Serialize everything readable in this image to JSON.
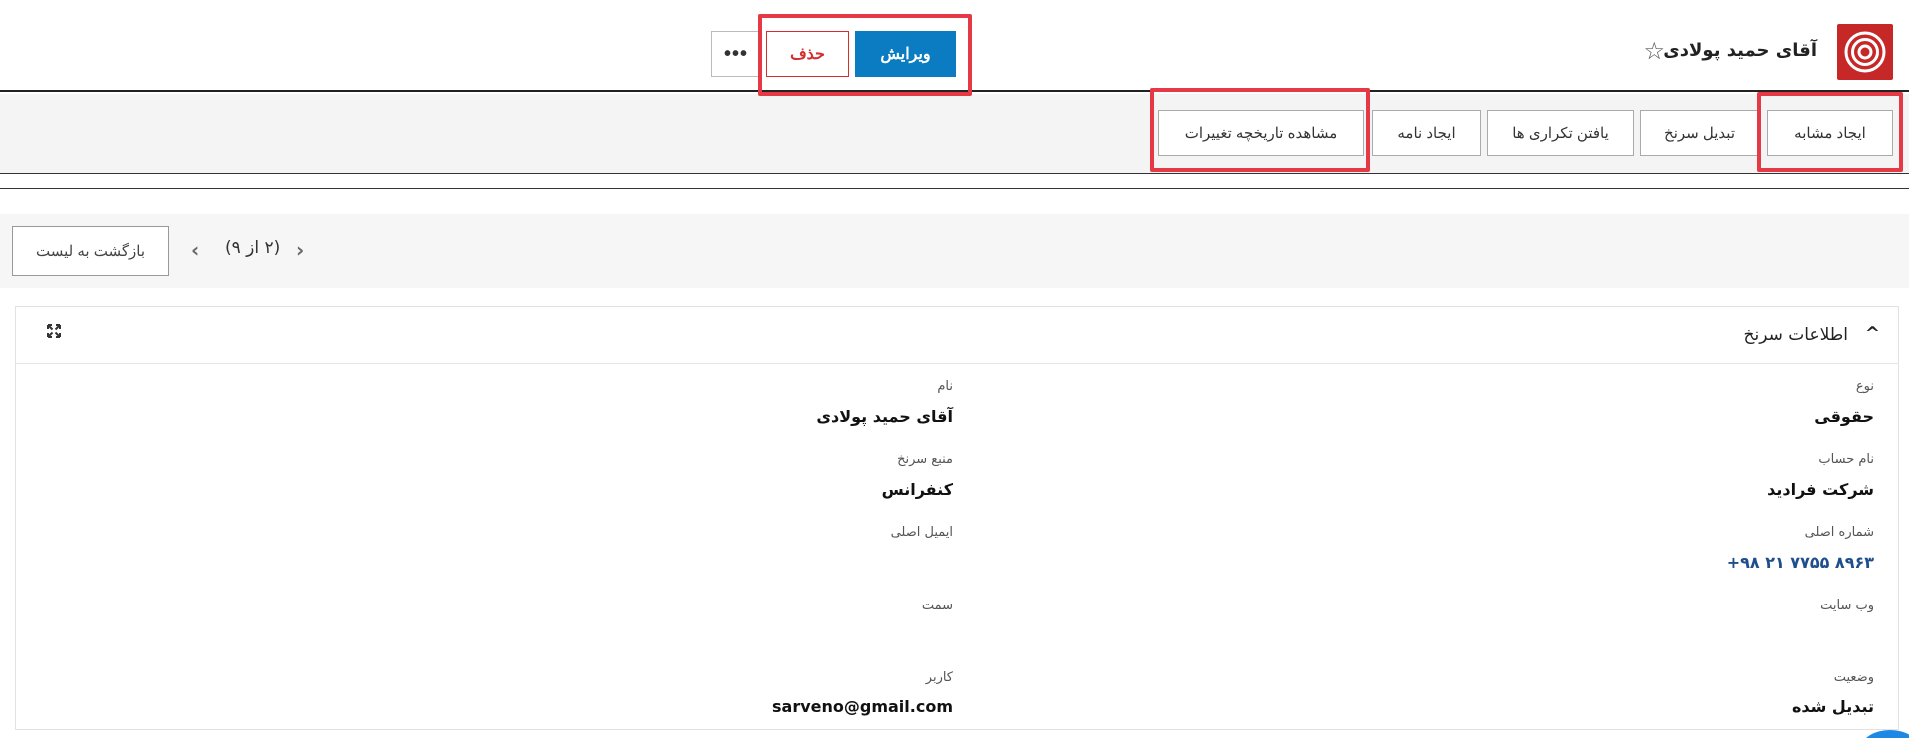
{
  "header": {
    "title": "آقای حمید پولادی",
    "edit_label": "ویرایش",
    "delete_label": "حذف",
    "more_label": "•••"
  },
  "toolbar": {
    "buttons": [
      {
        "label": "ایجاد مشابه"
      },
      {
        "label": "تبدیل سرنخ"
      },
      {
        "label": "یافتن تکراری ها"
      },
      {
        "label": "ایجاد نامه"
      },
      {
        "label": "مشاهده تاریخچه تغییرات"
      }
    ]
  },
  "nav": {
    "back_label": "بازگشت به لیست",
    "pager": "(۲ از ۹)"
  },
  "panel": {
    "title": "اطلاعات سرنخ",
    "fields": {
      "type_label": "نوع",
      "type_value": "حقوقی",
      "name_label": "نام",
      "name_value": "آقای حمید پولادی",
      "account_label": "نام حساب",
      "account_value": "شرکت فرادید",
      "source_label": "منبع سرنخ",
      "source_value": "کنفرانس",
      "phone_label": "شماره اصلی",
      "phone_value": "+۹۸ ۲۱ ۷۷۵۵ ۸۹۶۳",
      "email_label": "ایمیل اصلی",
      "website_label": "وب سایت",
      "position_label": "سمت",
      "status_label": "وضعیت",
      "status_value": "تبدیل شده",
      "user_label": "کاربر",
      "user_value": "sarveno@gmail.com"
    }
  },
  "colors": {
    "primary": "#0b7cc1",
    "danger": "#d32f2f",
    "brand": "#c62828",
    "highlight": "#e53945"
  }
}
